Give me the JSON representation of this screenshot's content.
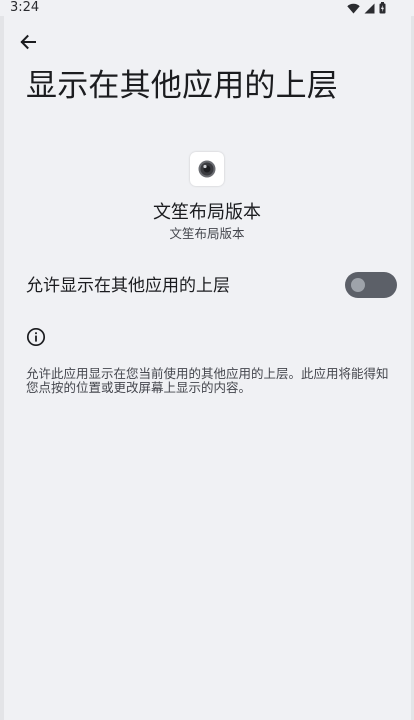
{
  "status_bar": {
    "time": "3:24",
    "icons": [
      "wifi-icon",
      "signal-icon",
      "battery-icon"
    ]
  },
  "toolbar": {
    "back_icon": "arrow-back-icon"
  },
  "page": {
    "title": "显示在其他应用的上层"
  },
  "app": {
    "icon": "app-icon",
    "name": "文笙布局版本",
    "subname": "文笙布局版本"
  },
  "permission": {
    "label": "允许显示在其他应用的上层",
    "enabled": false
  },
  "info": {
    "icon": "info-icon",
    "description": "允许此应用显示在您当前使用的其他应用的上层。此应用将能得知您点按的位置或更改屏幕上显示的内容。"
  },
  "colors": {
    "background": "#f0f1f4",
    "text_primary": "#1b1c1f",
    "text_secondary": "#44464d",
    "toggle_track_off": "#5c6068",
    "toggle_thumb_off": "#9ea3aa"
  }
}
